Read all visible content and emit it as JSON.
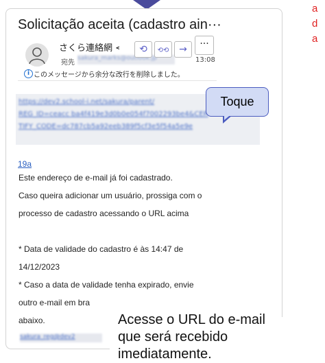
{
  "note_text": "a\nd\na",
  "email": {
    "subject": "Solicitação aceita (cadastro ain···",
    "sender": "さくら連絡網 <saku",
    "recipient_label": "宛先",
    "recipient_value": "sakura_marks@outlook.jp",
    "time": "13:08",
    "reply_icon": "⟲",
    "reply_all_icon": "⟲⟲",
    "forward_icon": "→",
    "more_icon": "···",
    "info_icon": "i",
    "info_notice": "このメッセージから余分な改行を削除しました。",
    "url_lines": [
      "https://dev2.school-i.net/sakura/parent/",
      "REG_ID=ceacc ba4f419e3d0b0e054f7002293be4&CER",
      "TIFY_CODE=dc787cb5a92eeb389f5cf3e5f54a5e9e"
    ],
    "link_fragment": "19a",
    "body_lines": [
      "Este endereço de e-mail já foi cadastrado.",
      "Caso queira adicionar um usuário, prossiga com o",
      "processo de cadastro acessando o URL acima",
      "",
      "* Data de validade do cadastro é às 14:47 de",
      "14/12/2023",
      "* Caso a data de validade tenha expirado, envie",
      "outro e-mail em bra",
      "abaixo."
    ],
    "bottom_link": "sakura_reg@dev2"
  },
  "callout": {
    "label": "Toque"
  },
  "caption": {
    "lines": [
      "Acesse o URL do e-mail",
      "que será recebido",
      "imediatamente."
    ]
  }
}
